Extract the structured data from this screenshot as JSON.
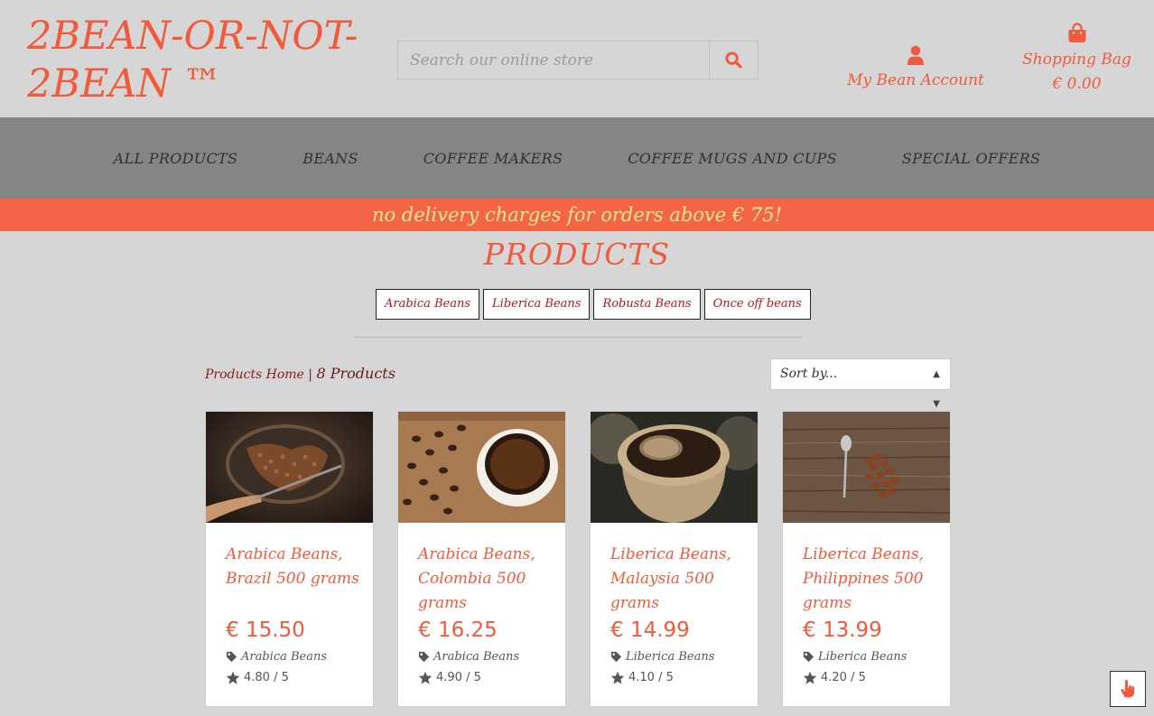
{
  "brand": {
    "line1": "2BEAN-OR-NOT-",
    "line2": "2BEAN ™"
  },
  "search": {
    "placeholder": "Search our online store"
  },
  "account": {
    "label": "My Bean Account"
  },
  "bag": {
    "label": "Shopping Bag",
    "amount": "€ 0.00"
  },
  "nav": [
    "ALL PRODUCTS",
    "BEANS",
    "COFFEE MAKERS",
    "COFFEE MUGS AND CUPS",
    "SPECIAL OFFERS"
  ],
  "promo": "no delivery charges for orders above € 75!",
  "page_title": "PRODUCTS",
  "categories": [
    "Arabica Beans",
    "Liberica Beans",
    "Robusta Beans",
    "Once off beans"
  ],
  "breadcrumb": {
    "home": "Products Home",
    "sep": " | ",
    "count": "8 Products"
  },
  "sort": {
    "label": "Sort by..."
  },
  "products": [
    {
      "name": "Arabica Beans, Brazil 500 grams",
      "price": "€ 15.50",
      "category": "Arabica Beans",
      "rating": "4.80 / 5"
    },
    {
      "name": "Arabica Beans, Colombia 500 grams",
      "price": "€ 16.25",
      "category": "Arabica Beans",
      "rating": "4.90 / 5"
    },
    {
      "name": "Liberica Beans, Malaysia 500 grams",
      "price": "€ 14.99",
      "category": "Liberica Beans",
      "rating": "4.10 / 5"
    },
    {
      "name": "Liberica Beans, Philippines 500 grams",
      "price": "€ 13.99",
      "category": "Liberica Beans",
      "rating": "4.20 / 5"
    }
  ],
  "colors": {
    "accent": "#f15a3c",
    "nav_bg": "#858585",
    "promo_bg": "#f46548",
    "promo_text": "#f2e98c",
    "page_bg": "#d6d6d6"
  }
}
